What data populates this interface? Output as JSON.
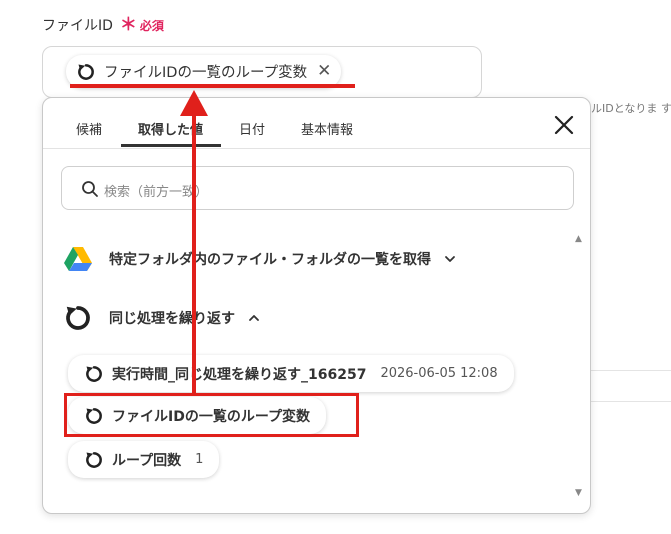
{
  "field": {
    "label": "ファイルID",
    "required_star": "＊",
    "required_text": "必須",
    "selected_chip": "ファイルIDの一覧のループ変数",
    "remove_icon": "close-icon",
    "help_text_partial": "ルIDとなりま す"
  },
  "popup": {
    "tabs": [
      {
        "label": "候補"
      },
      {
        "label": "取得した値",
        "active": true
      },
      {
        "label": "日付"
      },
      {
        "label": "基本情報"
      }
    ],
    "close_icon": "close-icon",
    "search": {
      "placeholder": "検索（前方一致）",
      "icon": "search-icon"
    },
    "groups": [
      {
        "label": "特定フォルダ内のファイル・フォルダの一覧を取得",
        "icon": "google-drive-icon",
        "expanded": false
      },
      {
        "label": "同じ処理を繰り返す",
        "icon": "loop-icon",
        "expanded": true
      }
    ],
    "items": [
      {
        "label": "実行時間_同じ処理を繰り返す_166257",
        "meta": "2026-06-05 12:08"
      },
      {
        "label": "ファイルIDの一覧のループ変数",
        "meta": ""
      },
      {
        "label": "ループ回数",
        "meta": "1"
      }
    ]
  },
  "colors": {
    "accent_red": "#e0201b",
    "required_pink": "#e0245e",
    "drive_green": "#1ea362",
    "drive_yellow": "#ffba00",
    "drive_blue": "#4285f4"
  }
}
